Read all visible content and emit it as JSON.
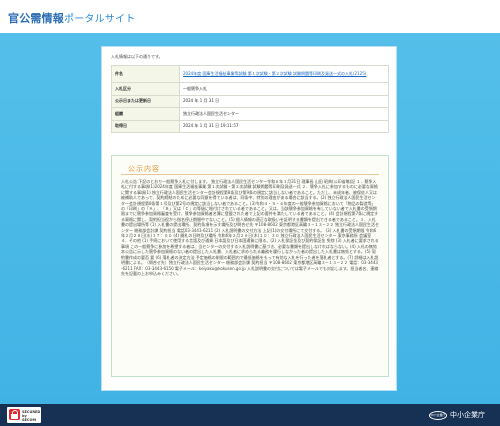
{
  "header": {
    "title": "官公需情報",
    "subtitle": "ポータルサイト"
  },
  "card": {
    "lead": "入札情報は以下の通りです。",
    "rows": [
      {
        "key": "件名",
        "value": "2024年度 国庫生活福祉事業等試験 第１次試験・第２次試験 試験問題等印刷及発送一式の入札(2125)"
      },
      {
        "key": "入札区分",
        "value": "一般競争入札"
      },
      {
        "key": "公示日または更新日",
        "value": "2024 年 1 月 31 日"
      },
      {
        "key": "組織",
        "value": "独立行政法人国民生活センター"
      },
      {
        "key": "取得日",
        "value": "2024 年 1 月 31 日 19:11:57"
      }
    ]
  },
  "content": {
    "title": "公示内容",
    "body": "入札公告 下記のとおり一般競争入札に付します。 独立行政法人国民生活センター令和６年１月31日 理事長 山田 昭典(公印省略)記 １．競争入札に付する事項(1)2024年度 国庫生活福祉事業 第１次試験・第２次試験 試験問題等印刷及発送一式 ２．競争入札に参加するものに必要な資格に関する事項(1) 独立行政法人国民生活センター会計規程第8条及び第9条の規定に該当しない者であること。ただし、未成年者、被保佐人又は被補助人であって、契約締結のために必要な同意を得ている者は、同条中、特別の理由がある場合に該当する。(2) 独立行政法人国民生活センター会計規程第8条第１号及び第2号の規定に該当しない者であること。(3)令和４・５・６年度の一般競争参加資格において「物品の製造等」の「印刷」の「Ａ」、「Ｂ」又は「Ｃ」の等級に格付けされている者であること。又は、当該競争参加資格を有していない者で入札書の受領期限までに競争参加資格審査を受け、競争参加資格者名簿に登載された者で上記の要件を満たしている者であること。(4) 会計規程第7条に規定する資格に関し、契約担当役から指名停止期間中でないこと。(5) 個人情報の適正な取扱いを証明する書類を提出できる者であること。３．入札書の提出場所等 (1) 入札書の提出場所、契約条項を示す場所及び問合せ先 〒108-8602 東京都港区高輪３−１３−２２ 独立行政法人国民生活センター 総務部会計課 契約担当 電話03-3443-6211 (2) 入札説明書の交付方法 上記(1)の交付場所にて交付する。 (3) 入札書の受領期限 令和6年２月２８日(水)１７：００ (4) 開札の日時及び場所 令和6年２月２９日(木)１０：３０ 独立行政法人国民生活センター 東京事務所 会議室 ４．その他 (1) 手続において使用する言語及び通貨 日本語及び日本国通貨に限る。(2) 入札保証金及び契約保証金 免除 (3) 入札者に要求される事項 この一般競争に参加を希望する者は、当センターの交付する入札説明書に基づき、必要な書類を提出しなければならない。(4) 入札の無効 本公告に示した競争参加資格のない者の提出した入札書、入札者に求められる義務を履行しなかった者の提出した入札書は無効とする。(5) 契約書作成の要否 要 (6) 落札者の決定方法 予定価格の制限の範囲内で最低価格をもって有効な入札を行った者を落札者とする。(7) 詳細は入札説明書による。（問合せ先）独立行政法人国民生活センター 総務部会計課 契約担当 〒108-8602 東京都港区高輪３−１３−２２ 電話：03-3443-6211 FAX：03-3443-6150 電子メール：keiyaku@kokusen.go.jp 入札説明書の交付については電子メールでも対応します。担当者名、連絡先を記載の上お申込みください。"
  },
  "footer": {
    "secured_line1": "SECURED",
    "secured_line2": "by SECOM",
    "ministry_mark": "中小企業庁",
    "ministry_name": "中小企業庁"
  },
  "colors": {
    "background": "#45b6e6",
    "title": "#2a6db5",
    "accent": "#e8963a",
    "footer": "#173155"
  }
}
